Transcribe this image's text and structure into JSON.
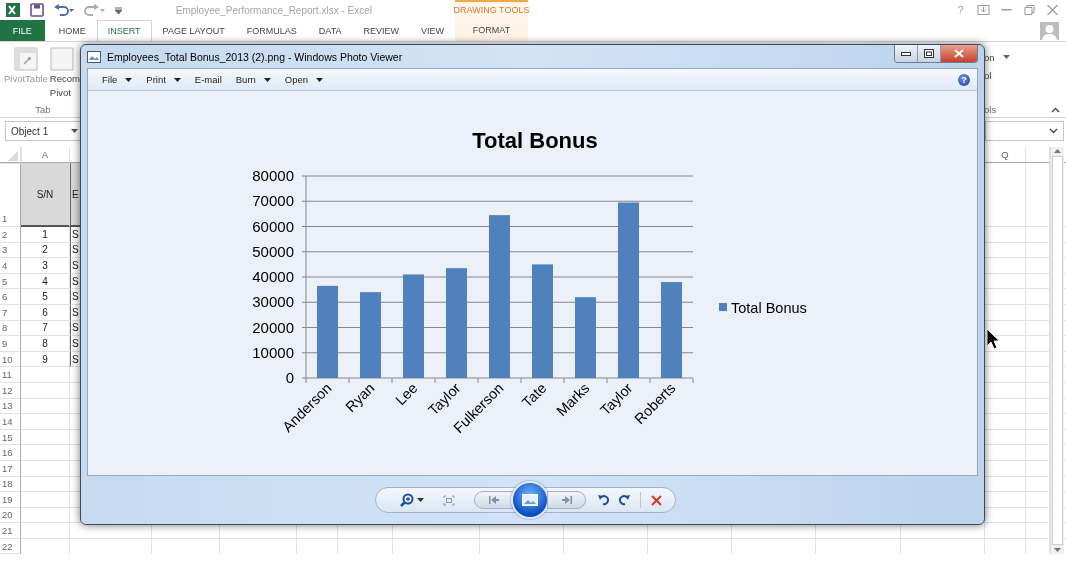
{
  "excel": {
    "title": "Employee_Performance_Report.xlsx - Excel",
    "help": "?",
    "tabs": [
      {
        "label": "FILE",
        "kind": "file",
        "selected": false
      },
      {
        "label": "HOME",
        "kind": "tab",
        "selected": false
      },
      {
        "label": "INSERT",
        "kind": "tab",
        "selected": true
      },
      {
        "label": "PAGE LAYOUT",
        "kind": "tab",
        "selected": false
      },
      {
        "label": "FORMULAS",
        "kind": "tab",
        "selected": false
      },
      {
        "label": "DATA",
        "kind": "tab",
        "selected": false
      },
      {
        "label": "REVIEW",
        "kind": "tab",
        "selected": false
      },
      {
        "label": "VIEW",
        "kind": "tab",
        "selected": false
      }
    ],
    "contextual_tabs": {
      "group": "DRAWING TOOLS",
      "tabs": [
        {
          "label": "FORMAT",
          "selected": false
        }
      ]
    },
    "ribbon": {
      "left_items": [
        {
          "lines": [
            "PivotTable"
          ]
        },
        {
          "lines": [
            "Recom",
            "Pivot"
          ]
        }
      ],
      "left_group_label": "Tab",
      "right_items": [
        {
          "label": "on",
          "dropdown": true
        },
        {
          "label": "ol",
          "dropdown": false
        }
      ],
      "right_group_label": "ols"
    },
    "name_box": "Object 1",
    "column_headers": [
      {
        "label": "A"
      },
      {
        "label": "Q"
      }
    ],
    "rows": [
      {
        "number": "1",
        "cells": [
          "S/N",
          "E"
        ]
      },
      {
        "number": "2",
        "cells": [
          "1",
          "S"
        ]
      },
      {
        "number": "3",
        "cells": [
          "2",
          "S"
        ]
      },
      {
        "number": "4",
        "cells": [
          "3",
          "S"
        ]
      },
      {
        "number": "5",
        "cells": [
          "4",
          "S"
        ]
      },
      {
        "number": "6",
        "cells": [
          "5",
          "S"
        ]
      },
      {
        "number": "7",
        "cells": [
          "6",
          "S"
        ]
      },
      {
        "number": "8",
        "cells": [
          "7",
          "S"
        ]
      },
      {
        "number": "9",
        "cells": [
          "8",
          "S"
        ]
      },
      {
        "number": "10",
        "cells": [
          "9",
          "S"
        ]
      },
      {
        "number": "11"
      },
      {
        "number": "12"
      },
      {
        "number": "13"
      },
      {
        "number": "14"
      },
      {
        "number": "15"
      },
      {
        "number": "16"
      },
      {
        "number": "17"
      },
      {
        "number": "18"
      },
      {
        "number": "19"
      },
      {
        "number": "20"
      },
      {
        "number": "21"
      },
      {
        "number": "22"
      }
    ]
  },
  "photo_viewer": {
    "title": "Employees_Total Bonus_2013 (2).png - Windows Photo Viewer",
    "help": "?",
    "menu": [
      {
        "label": "File",
        "dropdown": true
      },
      {
        "label": "Print",
        "dropdown": true
      },
      {
        "label": "E-mail",
        "dropdown": false
      },
      {
        "label": "Burn",
        "dropdown": true
      },
      {
        "label": "Open",
        "dropdown": true
      }
    ],
    "chart_data": {
      "type": "bar",
      "title": "Total Bonus",
      "categories": [
        "Anderson",
        "Ryan",
        "Lee",
        "Taylor",
        "Fulkerson",
        "Tate",
        "Marks",
        "Taylor",
        "Roberts"
      ],
      "series": [
        {
          "name": "Total Bonus",
          "color": "#4f81bd",
          "values": [
            36500,
            34000,
            41000,
            43500,
            64500,
            45000,
            32000,
            69500,
            38000
          ]
        }
      ],
      "grid": true,
      "ylim": [
        0,
        80000
      ],
      "yticks": [
        0,
        10000,
        20000,
        30000,
        40000,
        50000,
        60000,
        70000,
        80000
      ]
    }
  }
}
